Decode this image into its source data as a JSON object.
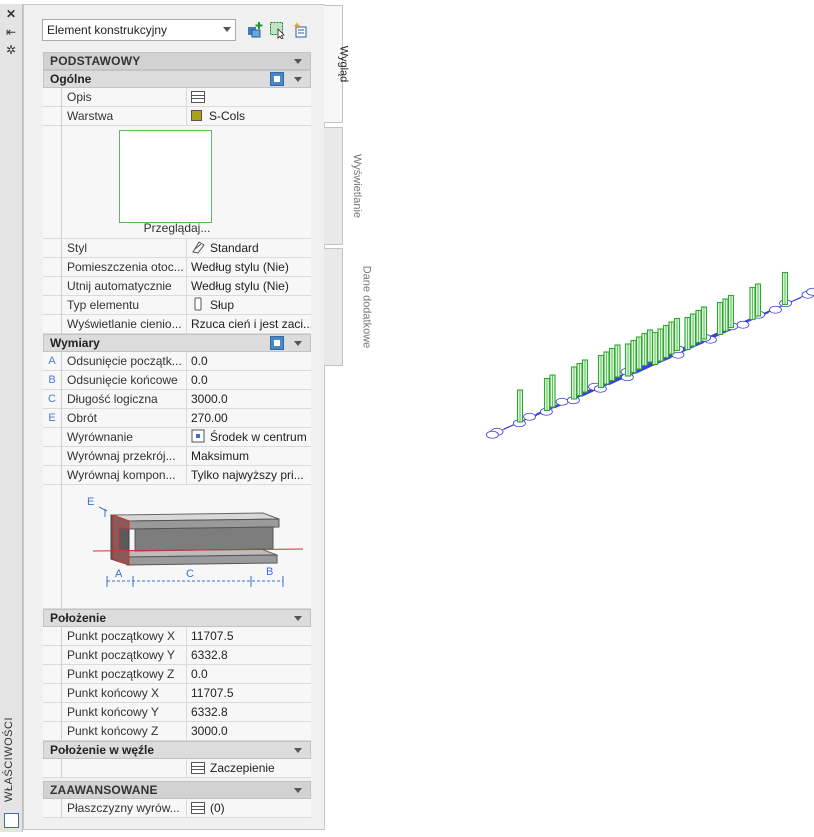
{
  "window": {
    "title": "WŁAŚCIWOŚCI"
  },
  "tabs": [
    {
      "label": "Wygląd",
      "active": true
    },
    {
      "label": "Wyświetlanie",
      "active": false
    },
    {
      "label": "Dane dodatkowe",
      "active": false
    }
  ],
  "toolbar": {
    "object_type": "Element konstrukcyjny",
    "icons": [
      "add-object-icon",
      "select-objects-icon",
      "quick-select-icon"
    ]
  },
  "sections": {
    "podstawowy": "PODSTAWOWY",
    "ogolne": "Ogólne",
    "wymiary": "Wymiary",
    "polozenie": "Położenie",
    "polozenie_wezle": "Położenie w węźle",
    "zaawansowane": "ZAAWANSOWANE"
  },
  "ogolne": {
    "opis": {
      "name": "Opis",
      "value": ""
    },
    "warstwa": {
      "name": "Warstwa",
      "value": "S-Cols",
      "color": "#a8a018"
    },
    "preview_label": "Przeglądaj...",
    "rows": [
      {
        "name": "Styl",
        "value": "Standard",
        "icon": "style-icon"
      },
      {
        "name": "Pomieszczenia  otoc...",
        "value": "Według stylu (Nie)"
      },
      {
        "name": "Utnij automatycznie",
        "value": "Według stylu (Nie)"
      },
      {
        "name": "Typ elementu",
        "value": "Słup",
        "icon": "column-icon"
      },
      {
        "name": "Wyświetlanie  cienio...",
        "value": "Rzuca cień i jest zaci..."
      }
    ]
  },
  "wymiary": {
    "rows": [
      {
        "marker": "A",
        "name": "Odsunięcie  początk...",
        "value": "0.0"
      },
      {
        "marker": "B",
        "name": "Odsunięcie końcowe",
        "value": "0.0"
      },
      {
        "marker": "C",
        "name": "Długość logiczna",
        "value": "3000.0"
      },
      {
        "marker": "E",
        "name": "Obrót",
        "value": "270.00"
      },
      {
        "marker": "",
        "name": "Wyrównanie",
        "value": "Środek w centrum",
        "icon": "justify-icon"
      },
      {
        "marker": "",
        "name": "Wyrównaj  przekrój...",
        "value": "Maksimum"
      },
      {
        "marker": "",
        "name": "Wyrównaj  kompon...",
        "value": "Tylko najwyższy pri..."
      }
    ],
    "diagram_labels": {
      "e": "E",
      "a": "A",
      "c": "C",
      "b": "B"
    }
  },
  "polozenie": {
    "rows": [
      {
        "name": "Punkt początkowy X",
        "value": "11707.5"
      },
      {
        "name": "Punkt początkowy Y",
        "value": "6332.8"
      },
      {
        "name": "Punkt początkowy Z",
        "value": "0.0"
      },
      {
        "name": "Punkt końcowy X",
        "value": "11707.5"
      },
      {
        "name": "Punkt końcowy Y",
        "value": "6332.8"
      },
      {
        "name": "Punkt końcowy Z",
        "value": "3000.0"
      }
    ]
  },
  "polozenie_wezle": {
    "value": "Zaczepienie"
  },
  "zaawansowane": {
    "rows": [
      {
        "name": "Płaszczyzny  wyrów...",
        "value": "(0)"
      }
    ]
  },
  "colors": {
    "column": "#2fa82f",
    "grid": "#3b3bd6"
  }
}
